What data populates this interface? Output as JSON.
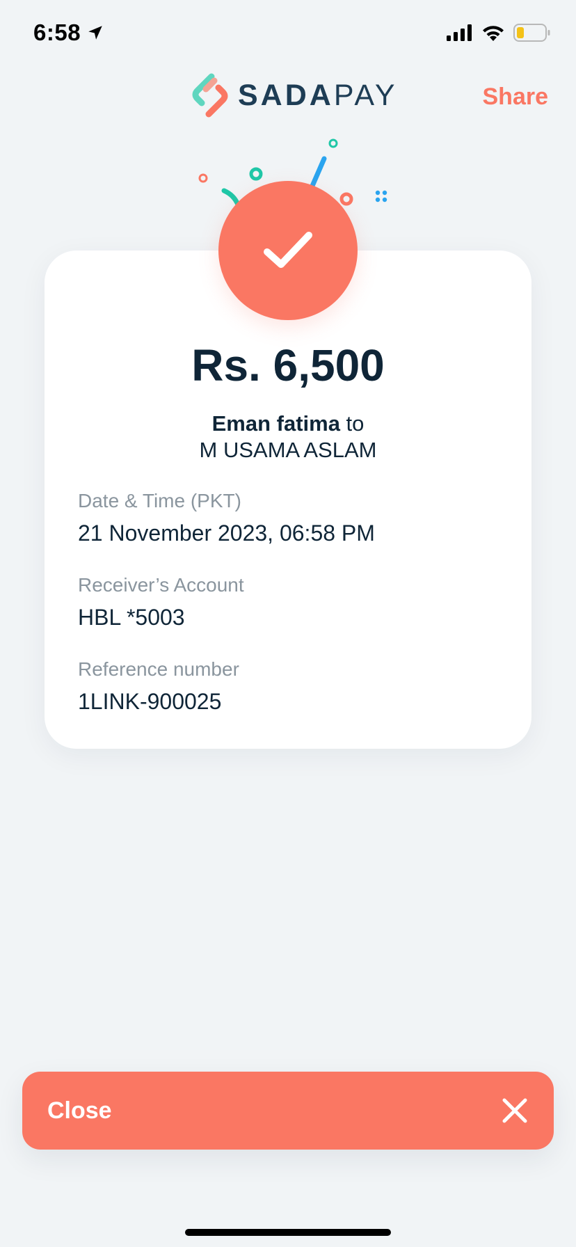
{
  "status_bar": {
    "time": "6:58",
    "location_icon": "location-arrow-icon",
    "signal_icon": "cellular-signal-icon",
    "wifi_icon": "wifi-icon",
    "battery_icon": "battery-low-icon"
  },
  "header": {
    "logo_text_strong": "SADA",
    "logo_text_light": "PAY",
    "share_label": "Share"
  },
  "receipt": {
    "status_icon": "checkmark-icon",
    "amount": "Rs. 6,500",
    "sender": "Eman fatima",
    "connector": " to",
    "receiver": "M USAMA ASLAM",
    "details": [
      {
        "label": "Date & Time (PKT)",
        "value": "21 November 2023, 06:58 PM"
      },
      {
        "label": "Receiver’s Account",
        "value": "HBL *5003"
      },
      {
        "label": "Reference number",
        "value": "1LINK-900025"
      }
    ]
  },
  "footer": {
    "close_label": "Close",
    "close_icon": "close-icon"
  },
  "colors": {
    "accent": "#fa7763",
    "text_primary": "#0f2537",
    "text_secondary": "#8a959e",
    "background": "#f1f4f6",
    "card": "#ffffff",
    "brand_navy": "#1e3d55",
    "confetti_teal": "#1fc7a7",
    "confetti_blue": "#2aa4ef"
  }
}
